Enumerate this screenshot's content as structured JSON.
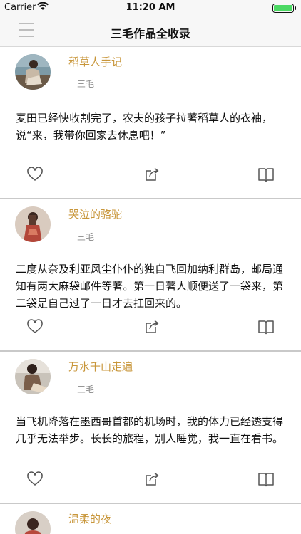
{
  "status_bar": {
    "carrier": "Carrier",
    "time": "11:20 AM"
  },
  "nav": {
    "title": "三毛作品全收录"
  },
  "posts": [
    {
      "title": "稻草人手记",
      "author": "三毛",
      "excerpt": "麦田已经快收割完了，农夫的孩子拉著稻草人的衣袖，说“来，我带你回家去休息吧！”"
    },
    {
      "title": "哭泣的骆驼",
      "author": "三毛",
      "excerpt": "二度从奈及利亚风尘仆仆的独自飞回加纳利群岛，邮局通知有两大麻袋邮件等著。第一日著人顺便送了一袋来，第二袋是自己过了一日才去扛回来的。"
    },
    {
      "title": "万水千山走遍",
      "author": "三毛",
      "excerpt": "当飞机降落在墨西哥首都的机场时，我的体力已经透支得几乎无法举步。长长的旅程，别人睡觉，我一直在看书。"
    },
    {
      "title": "温柔的夜",
      "author": "",
      "excerpt": ""
    }
  ],
  "colors": {
    "accent": "#c8963a",
    "divider": "#c9c9c9",
    "battery": "#4cd964"
  },
  "icons": {
    "like": "heart-icon",
    "share": "share-icon",
    "read": "book-icon",
    "menu": "menu-icon"
  }
}
